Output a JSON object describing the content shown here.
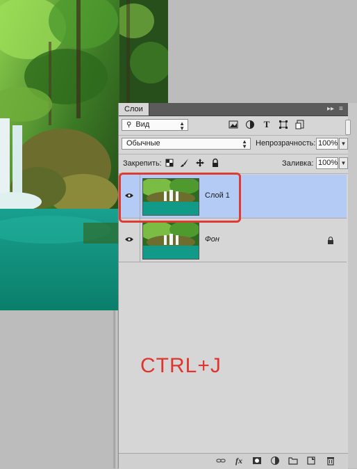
{
  "panel": {
    "tab_label": "Слои",
    "collapse_icon": "double-chevron-right-icon",
    "menu_icon": "panel-menu-icon"
  },
  "filter": {
    "kind_label": "Вид",
    "icons": [
      "image-filter-icon",
      "adjustment-filter-icon",
      "text-filter-icon",
      "shape-filter-icon",
      "smart-object-filter-icon"
    ]
  },
  "blend": {
    "mode": "Обычные",
    "opacity_label": "Непрозрачность:",
    "opacity_value": "100%"
  },
  "lock": {
    "label": "Закрепить:",
    "fill_label": "Заливка:",
    "fill_value": "100%"
  },
  "layers": [
    {
      "name": "Слой 1",
      "selected": true,
      "visible": true,
      "locked": false
    },
    {
      "name": "Фон",
      "selected": false,
      "visible": true,
      "locked": true
    }
  ],
  "annotation": {
    "shortcut": "CTRL+J",
    "highlight_color": "#e03b32"
  },
  "colors": {
    "selected_layer": "#b4ccf5",
    "panel_bg": "#d6d6d6",
    "tab_bar": "#5b5b5b"
  }
}
